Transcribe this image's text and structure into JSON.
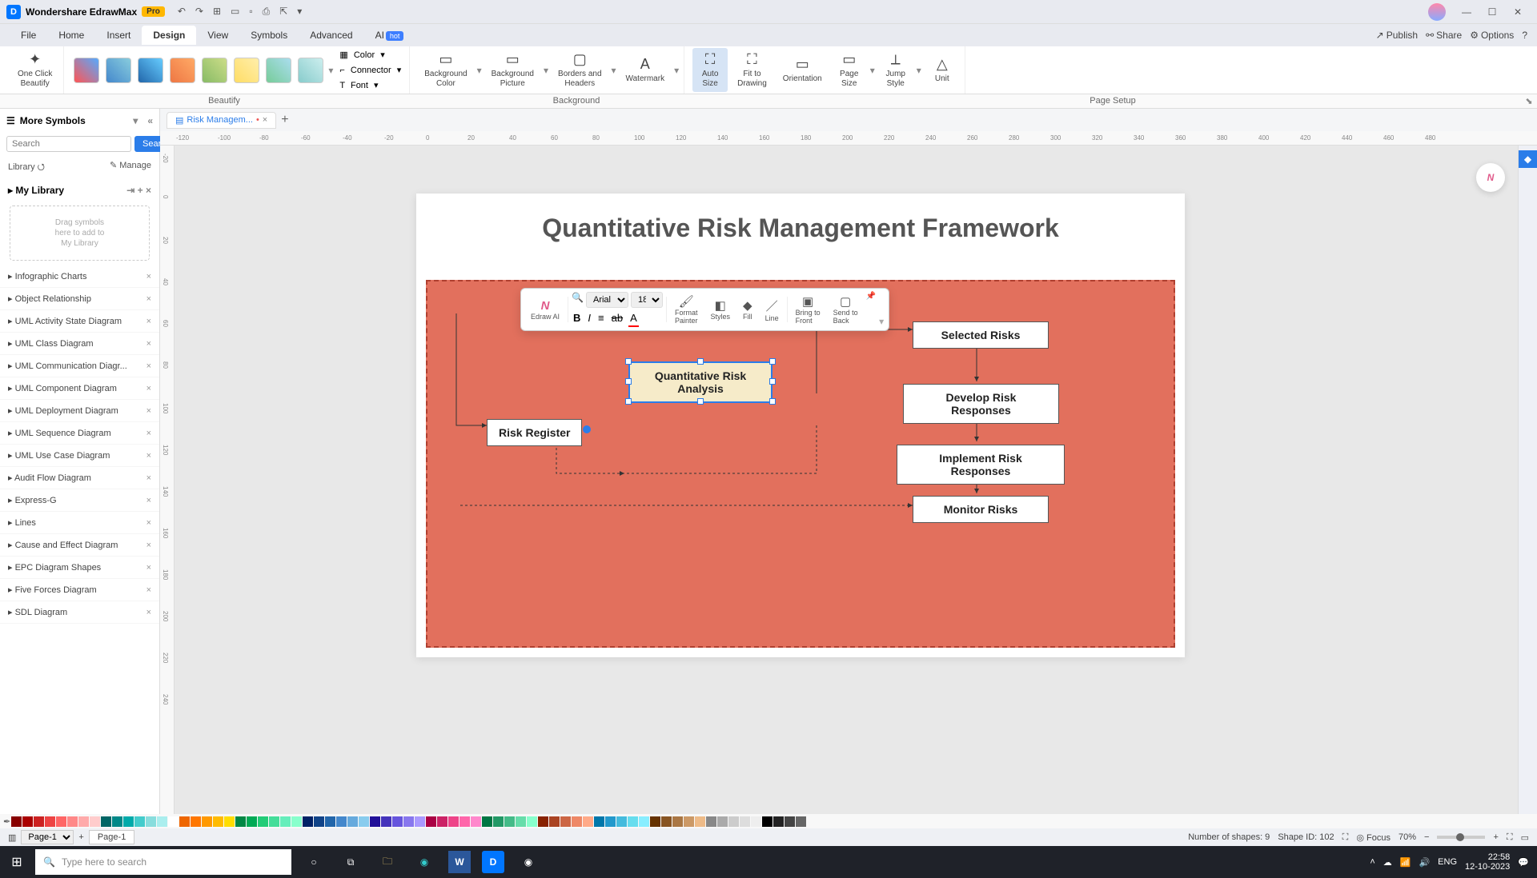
{
  "app": {
    "title": "Wondershare EdrawMax",
    "badge": "Pro"
  },
  "menubar": {
    "items": [
      "File",
      "Home",
      "Insert",
      "Design",
      "View",
      "Symbols",
      "Advanced",
      "AI"
    ],
    "active": "Design",
    "ai_badge": "hot",
    "right": {
      "publish": "Publish",
      "share": "Share",
      "options": "Options"
    }
  },
  "ribbon": {
    "one_click": "One Click\nBeautify",
    "color": "Color",
    "connector": "Connector",
    "font": "Font",
    "bg_color": "Background\nColor",
    "bg_pic": "Background\nPicture",
    "borders": "Borders and\nHeaders",
    "watermark": "Watermark",
    "auto_size": "Auto\nSize",
    "fit": "Fit to\nDrawing",
    "orientation": "Orientation",
    "page_size": "Page\nSize",
    "jump_style": "Jump\nStyle",
    "unit": "Unit",
    "section_beautify": "Beautify",
    "section_background": "Background",
    "section_page_setup": "Page Setup"
  },
  "left": {
    "more_symbols": "More Symbols",
    "search_placeholder": "Search",
    "search_btn": "Search",
    "library": "Library",
    "manage": "Manage",
    "my_library": "My Library",
    "dropzone": "Drag symbols\nhere to add to\nMy Library",
    "libs": [
      "Infographic Charts",
      "Object Relationship",
      "UML Activity State Diagram",
      "UML Class Diagram",
      "UML Communication Diagr...",
      "UML Component Diagram",
      "UML Deployment Diagram",
      "UML Sequence Diagram",
      "UML Use Case Diagram",
      "Audit Flow Diagram",
      "Express-G",
      "Lines",
      "Cause and Effect Diagram",
      "EPC Diagram Shapes",
      "Five Forces Diagram",
      "SDL Diagram"
    ]
  },
  "tab": {
    "name": "Risk Managem...",
    "modified": "•"
  },
  "float": {
    "ai": "Edraw AI",
    "font": "Arial",
    "size": "18",
    "format_painter": "Format\nPainter",
    "styles": "Styles",
    "fill": "Fill",
    "line": "Line",
    "front": "Bring to\nFront",
    "back": "Send to\nBack"
  },
  "diagram": {
    "title": "Quantitative Risk Management Framework",
    "n_qra": "Quantitative Risk\nAnalysis",
    "n_reg": "Risk Register",
    "n_sel": "Selected Risks",
    "n_dev": "Develop Risk Responses",
    "n_imp": "Implement Risk Responses",
    "n_mon": "Monitor Risks"
  },
  "status": {
    "page_sel": "Page-1",
    "page_tab": "Page-1",
    "shapes": "Number of shapes: 9",
    "shape_id": "Shape ID: 102",
    "focus": "Focus",
    "zoom": "70%"
  },
  "taskbar": {
    "search": "Type here to search",
    "lang": "ENG",
    "time": "22:58",
    "date": "12-10-2023"
  },
  "ruler_h": [
    "-120",
    "-100",
    "-80",
    "-60",
    "-40",
    "-20",
    "0",
    "20",
    "40",
    "60",
    "80",
    "100",
    "120",
    "140",
    "160",
    "180",
    "200",
    "220",
    "240",
    "260",
    "280",
    "300",
    "320",
    "340",
    "360",
    "380",
    "400",
    "420",
    "440",
    "460",
    "480"
  ],
  "ruler_v": [
    "-20",
    "0",
    "20",
    "40",
    "60",
    "80",
    "100",
    "120",
    "140",
    "160",
    "180",
    "200",
    "220",
    "240"
  ]
}
